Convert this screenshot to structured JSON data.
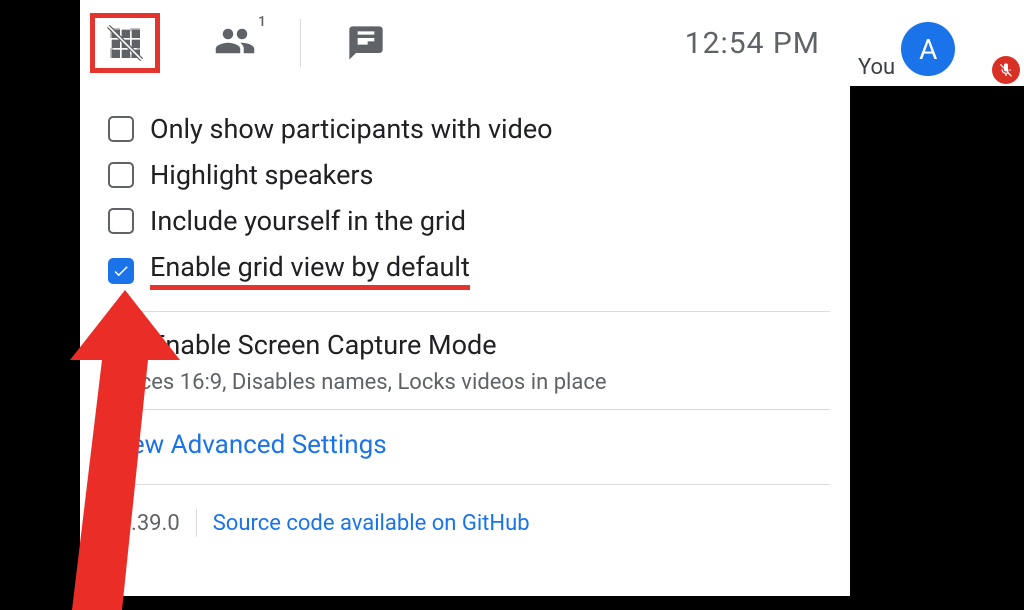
{
  "topbar": {
    "time": "12:54 PM",
    "people_count": "1"
  },
  "user": {
    "you_label": "You",
    "avatar_letter": "A"
  },
  "options": {
    "only_video": {
      "label": "Only show participants with video",
      "checked": false
    },
    "highlight": {
      "label": "Highlight speakers",
      "checked": false
    },
    "include_self": {
      "label": "Include yourself in the grid",
      "checked": false
    },
    "enable_default": {
      "label": "Enable grid view by default",
      "checked": true
    },
    "screen_capture": {
      "label": "Enable Screen Capture Mode",
      "checked": false
    },
    "screen_capture_help": "Forces 16:9, Disables names, Locks videos in place"
  },
  "links": {
    "advanced": "View Advanced Settings",
    "github": "Source code available on GitHub"
  },
  "footer": {
    "version": "v1.39.0"
  }
}
